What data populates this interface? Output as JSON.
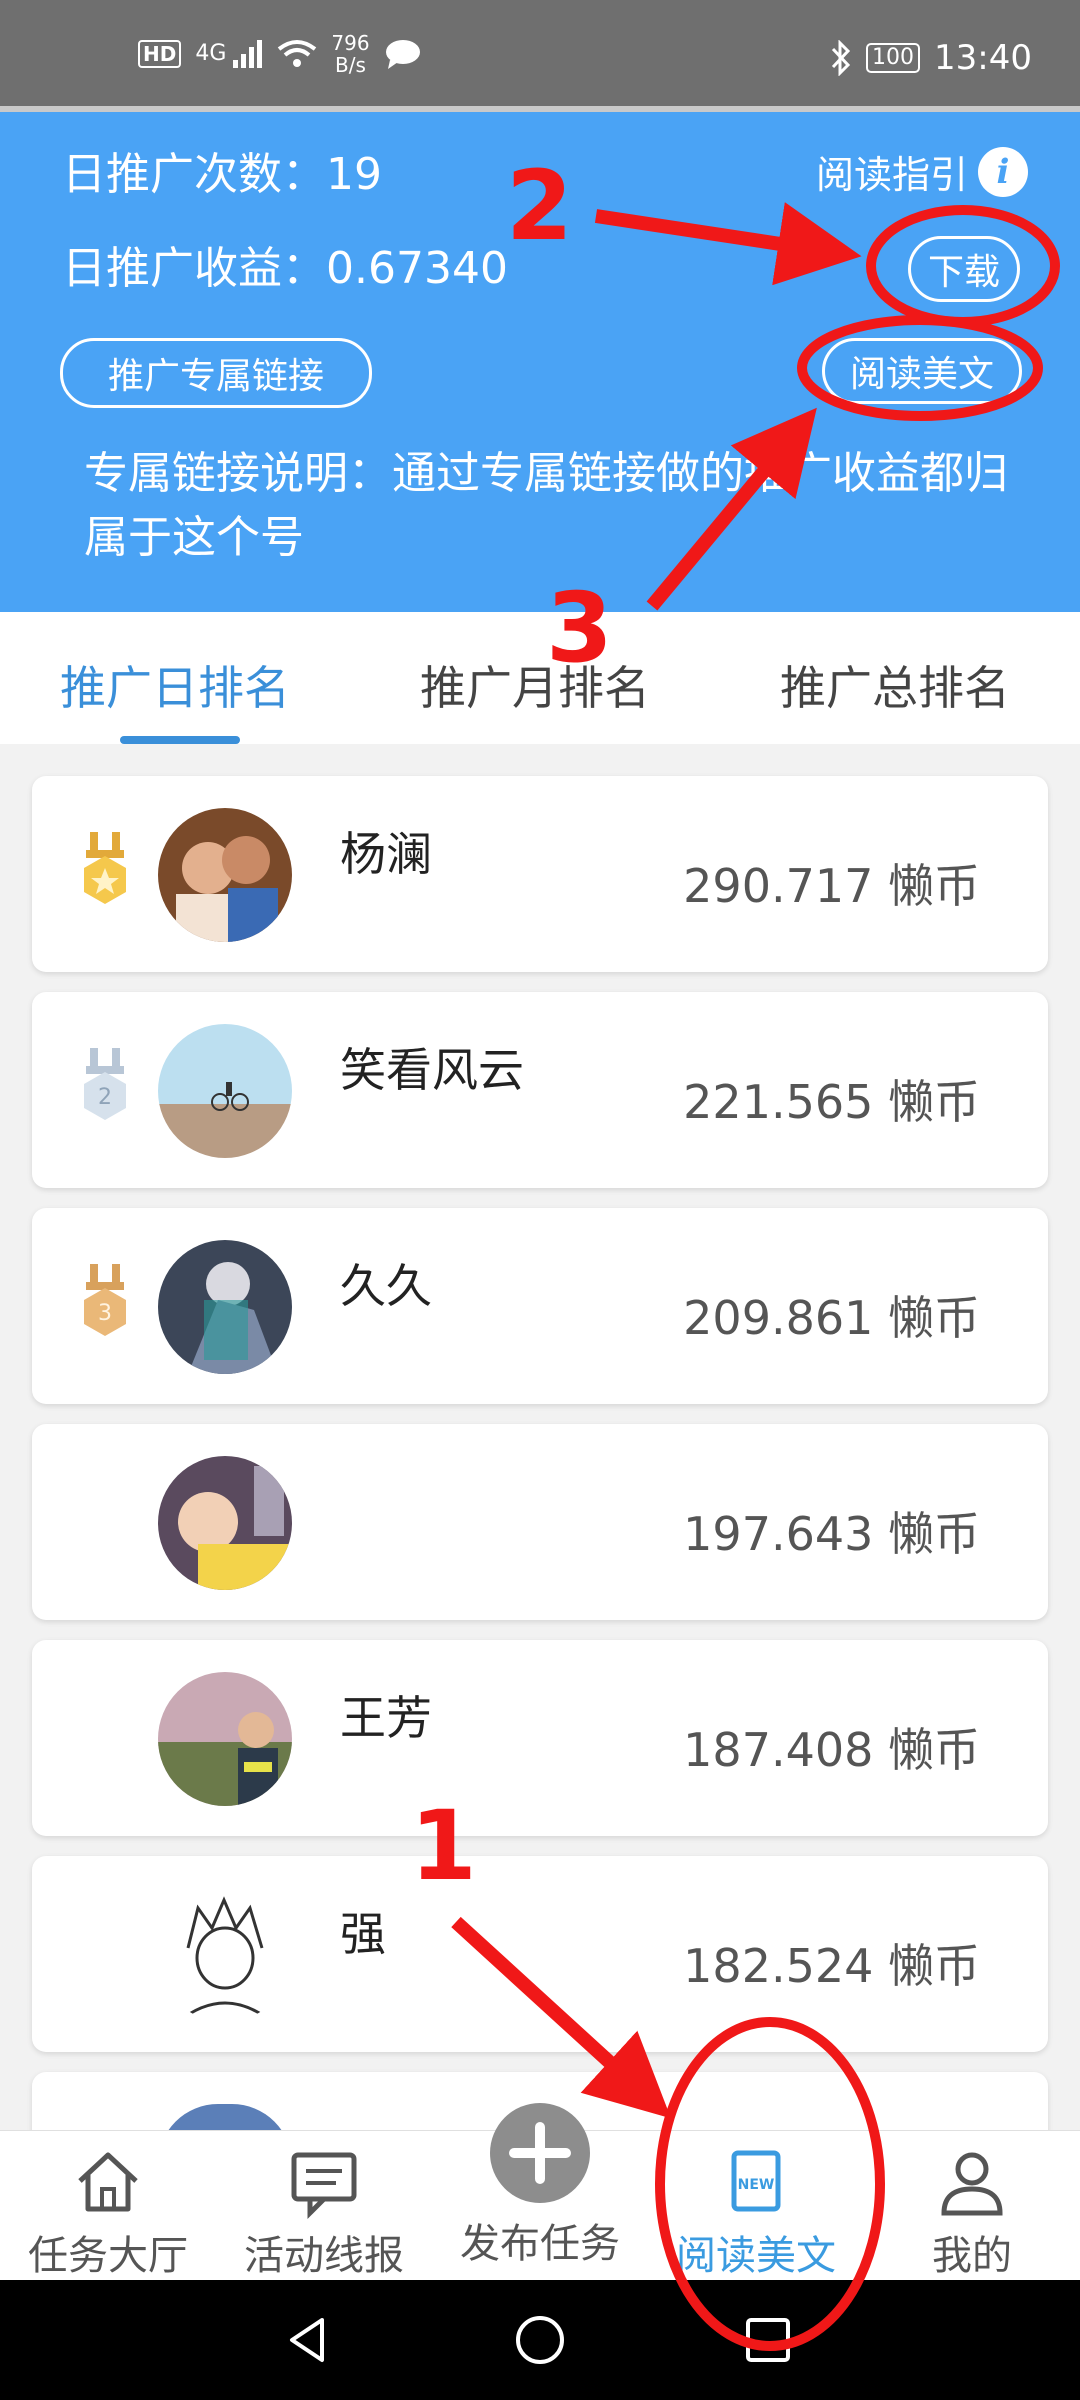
{
  "status": {
    "hd": "HD",
    "signal": "4G",
    "netspeed_value": "796",
    "netspeed_unit": "B/s",
    "battery": "100",
    "time": "13:40"
  },
  "header": {
    "daily_count": "日推广次数：19",
    "daily_income": "日推广收益：0.67340",
    "guide": "阅读指引",
    "download": "下载",
    "link_button": "推广专属链接",
    "read_button": "阅读美文",
    "desc": "专属链接说明：通过专属链接做的推广收益都归属于这个号"
  },
  "tabs": [
    "推广日排名",
    "推广月排名",
    "推广总排名"
  ],
  "ranking": [
    {
      "name": "杨澜",
      "score": "290.717 懒币",
      "medal": "1"
    },
    {
      "name": "笑看风云",
      "score": "221.565 懒币",
      "medal": "2"
    },
    {
      "name": "久久",
      "score": "209.861 懒币",
      "medal": "3"
    },
    {
      "name": "",
      "score": "197.643 懒币",
      "medal": ""
    },
    {
      "name": "王芳",
      "score": "187.408 懒币",
      "medal": ""
    },
    {
      "name": "强",
      "score": "182.524 懒币",
      "medal": ""
    }
  ],
  "nav": [
    {
      "label": "任务大厅",
      "icon": "home-icon"
    },
    {
      "label": "活动线报",
      "icon": "message-icon"
    },
    {
      "label": "发布任务",
      "icon": "plus-icon"
    },
    {
      "label": "阅读美文",
      "icon": "new-icon",
      "badge": "NEW"
    },
    {
      "label": "我的",
      "icon": "user-icon"
    }
  ],
  "annotations": [
    "1",
    "2",
    "3"
  ],
  "colors": {
    "header": "#4aa3f5",
    "accent": "#3a8fd9",
    "annotation": "#f01818"
  }
}
